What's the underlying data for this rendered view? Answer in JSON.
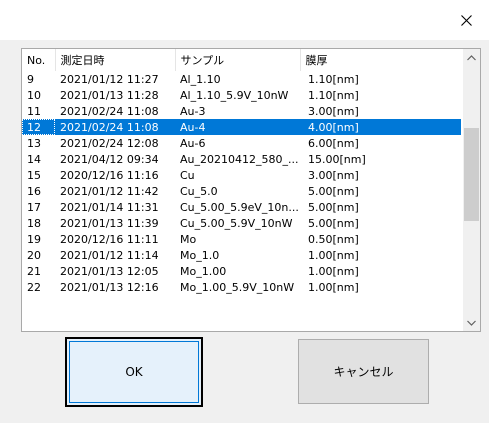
{
  "window": {
    "close_glyph": "close-icon"
  },
  "table": {
    "columns": [
      "No.",
      "測定日時",
      "サンプル",
      "膜厚"
    ],
    "rows": [
      {
        "no": "9",
        "date": "2021/01/12 11:27",
        "sample": "Al_1.10",
        "thick": "1.10[nm]"
      },
      {
        "no": "10",
        "date": "2021/01/13 11:28",
        "sample": "Al_1.10_5.9V_10nW",
        "thick": "1.10[nm]"
      },
      {
        "no": "11",
        "date": "2021/02/24 11:08",
        "sample": "Au-3",
        "thick": "3.00[nm]"
      },
      {
        "no": "12",
        "date": "2021/02/24 11:08",
        "sample": "Au-4",
        "thick": "4.00[nm]"
      },
      {
        "no": "13",
        "date": "2021/02/24 12:08",
        "sample": "Au-6",
        "thick": "6.00[nm]"
      },
      {
        "no": "14",
        "date": "2021/04/12 09:34",
        "sample": "Au_20210412_580_...",
        "thick": "15.00[nm]"
      },
      {
        "no": "15",
        "date": "2020/12/16 11:16",
        "sample": "Cu",
        "thick": "3.00[nm]"
      },
      {
        "no": "16",
        "date": "2021/01/12 11:42",
        "sample": "Cu_5.0",
        "thick": "5.00[nm]"
      },
      {
        "no": "17",
        "date": "2021/01/14 11:31",
        "sample": "Cu_5.00_5.9eV_10n...",
        "thick": "5.00[nm]"
      },
      {
        "no": "18",
        "date": "2021/01/13 11:39",
        "sample": "Cu_5.00_5.9V_10nW",
        "thick": "5.00[nm]"
      },
      {
        "no": "19",
        "date": "2020/12/16 11:11",
        "sample": "Mo",
        "thick": "0.50[nm]"
      },
      {
        "no": "20",
        "date": "2021/01/12 11:14",
        "sample": "Mo_1.0",
        "thick": "1.00[nm]"
      },
      {
        "no": "21",
        "date": "2021/01/13 12:05",
        "sample": "Mo_1.00",
        "thick": "1.00[nm]"
      },
      {
        "no": "22",
        "date": "2021/01/13 12:16",
        "sample": "Mo_1.00_5.9V_10nW",
        "thick": "1.00[nm]"
      }
    ],
    "selected_row_no": "12"
  },
  "buttons": {
    "ok": "OK",
    "cancel": "キャンセル"
  },
  "colors": {
    "selection": "#0078d7",
    "background": "#f0f0f0"
  }
}
